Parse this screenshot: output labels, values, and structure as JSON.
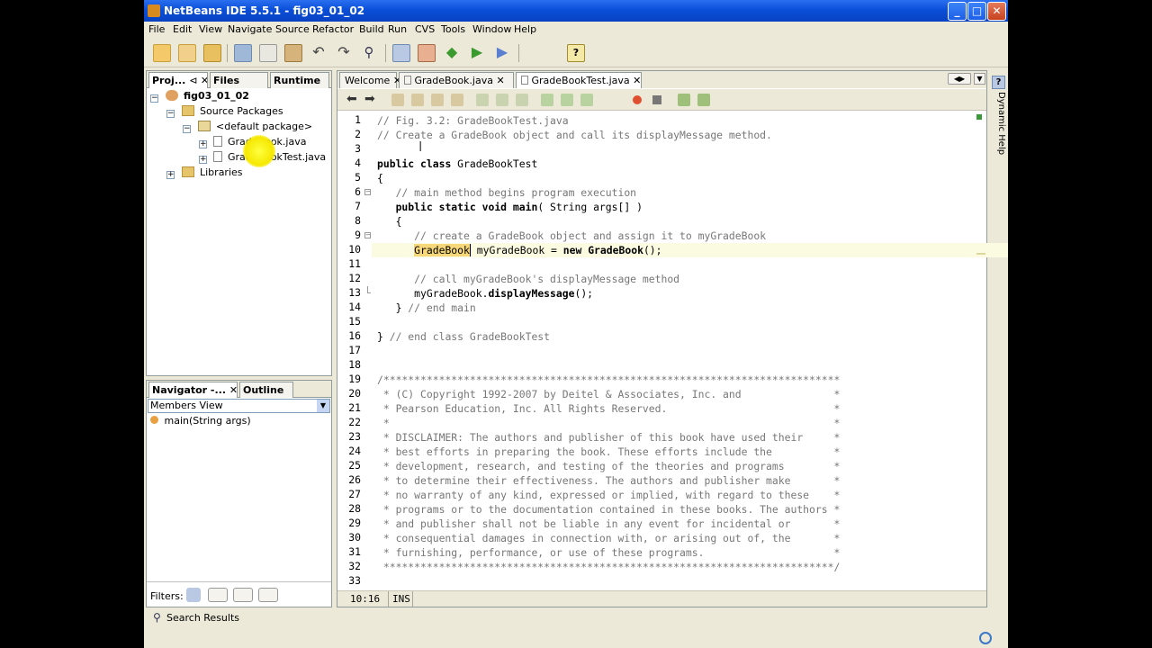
{
  "window": {
    "title": "NetBeans IDE 5.5.1 - fig03_01_02"
  },
  "menu": [
    "File",
    "Edit",
    "View",
    "Navigate",
    "Source",
    "Refactor",
    "Build",
    "Run",
    "CVS",
    "Tools",
    "Window",
    "Help"
  ],
  "left_tabs": [
    {
      "label": "Proj..."
    },
    {
      "label": "Files"
    },
    {
      "label": "Runtime"
    }
  ],
  "tree": [
    {
      "label": "fig03_01_02"
    },
    {
      "label": "Source Packages"
    },
    {
      "label": "<default package>"
    },
    {
      "label": "GradeBook.java"
    },
    {
      "label": "GradeBookTest.java"
    },
    {
      "label": "Libraries"
    }
  ],
  "navigator": {
    "tabs": [
      {
        "label": "Navigator -..."
      },
      {
        "label": "Outline"
      }
    ],
    "view": "Members View",
    "members": [
      "main(String args)"
    ],
    "filters_label": "Filters:"
  },
  "search_results": "Search Results",
  "editor_tabs": [
    {
      "label": "Welcome"
    },
    {
      "label": "GradeBook.java"
    },
    {
      "label": "GradeBookTest.java"
    }
  ],
  "right_sidebar": "Dynamic Help",
  "code_lines": [
    {
      "n": "1",
      "t": "// Fig. 3.2: GradeBookTest.java"
    },
    {
      "n": "2",
      "t": "// Create a GradeBook object and call its displayMessage method."
    },
    {
      "n": "3",
      "t": ""
    },
    {
      "n": "4",
      "t": "public class GradeBookTest"
    },
    {
      "n": "5",
      "t": "{"
    },
    {
      "n": "6",
      "t": "   // main method begins program execution"
    },
    {
      "n": "7",
      "t": "   public static void main( String args[] )"
    },
    {
      "n": "8",
      "t": "   {"
    },
    {
      "n": "9",
      "t": "      // create a GradeBook object and assign it to myGradeBook"
    },
    {
      "n": "10",
      "t": "      GradeBook myGradeBook = new GradeBook();"
    },
    {
      "n": "11",
      "t": ""
    },
    {
      "n": "12",
      "t": "      // call myGradeBook's displayMessage method"
    },
    {
      "n": "13",
      "t": "      myGradeBook.displayMessage();"
    },
    {
      "n": "14",
      "t": "   } // end main"
    },
    {
      "n": "15",
      "t": ""
    },
    {
      "n": "16",
      "t": "} // end class GradeBookTest"
    },
    {
      "n": "17",
      "t": ""
    },
    {
      "n": "18",
      "t": ""
    },
    {
      "n": "19",
      "t": "/**************************************************************************"
    },
    {
      "n": "20",
      "t": " * (C) Copyright 1992-2007 by Deitel & Associates, Inc. and               *"
    },
    {
      "n": "21",
      "t": " * Pearson Education, Inc. All Rights Reserved.                           *"
    },
    {
      "n": "22",
      "t": " *                                                                        *"
    },
    {
      "n": "23",
      "t": " * DISCLAIMER: The authors and publisher of this book have used their     *"
    },
    {
      "n": "24",
      "t": " * best efforts in preparing the book. These efforts include the          *"
    },
    {
      "n": "25",
      "t": " * development, research, and testing of the theories and programs        *"
    },
    {
      "n": "26",
      "t": " * to determine their effectiveness. The authors and publisher make       *"
    },
    {
      "n": "27",
      "t": " * no warranty of any kind, expressed or implied, with regard to these    *"
    },
    {
      "n": "28",
      "t": " * programs or to the documentation contained in these books. The authors *"
    },
    {
      "n": "29",
      "t": " * and publisher shall not be liable in any event for incidental or       *"
    },
    {
      "n": "30",
      "t": " * consequential damages in connection with, or arising out of, the       *"
    },
    {
      "n": "31",
      "t": " * furnishing, performance, or use of these programs.                     *"
    },
    {
      "n": "32",
      "t": " *************************************************************************/"
    },
    {
      "n": "33",
      "t": ""
    }
  ],
  "status": {
    "position": "10:16",
    "mode": "INS"
  },
  "colors": {
    "title_blue": "#0a4fd8",
    "current_line": "#fbfbe1",
    "comment": "#777777",
    "cursor_highlight": "#ffff40"
  }
}
